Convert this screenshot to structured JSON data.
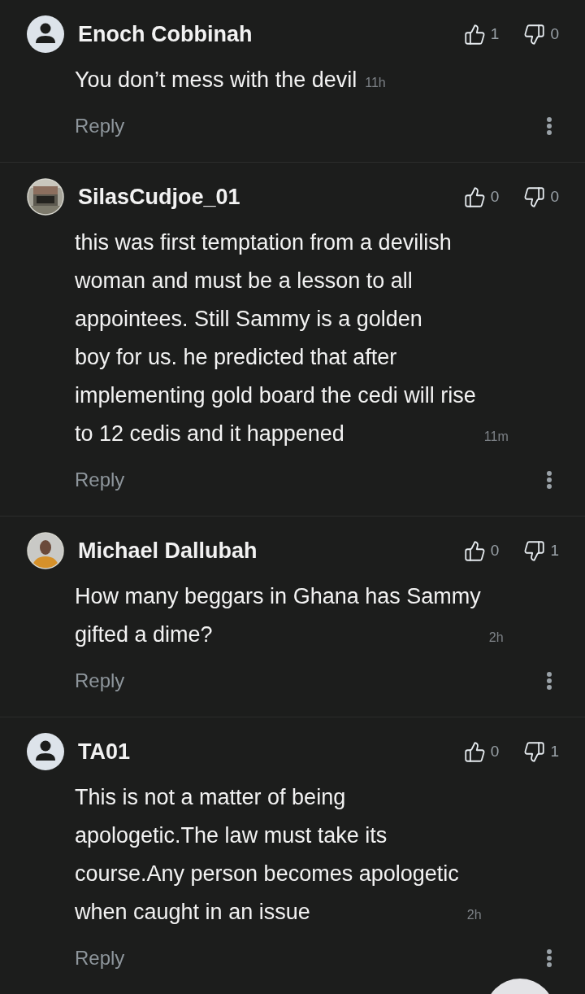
{
  "comments": [
    {
      "author": "Enoch Cobbinah",
      "avatar": {
        "kind": "default"
      },
      "likes": "1",
      "dislikes": "0",
      "lines": [
        "You don’t mess with the devil"
      ],
      "time": "11h",
      "reply": "Reply"
    },
    {
      "author": "SilasCudjoe_01",
      "likes": "0",
      "dislikes": "0",
      "lines": [
        "this was first temptation from a devilish",
        "woman and must be a lesson to all",
        "appointees. Still Sammy is a golden",
        "boy for us. he predicted that after",
        "implementing gold board the cedi will rise",
        "to 12 cedis and it happened"
      ],
      "time": "11m",
      "reply": "Reply"
    },
    {
      "author": "Michael Dallubah",
      "avatar": {
        "kind": "portrait"
      },
      "likes": "0",
      "dislikes": "1",
      "lines": [
        "How many beggars in Ghana has Sammy",
        "gifted a dime?"
      ],
      "time": "2h",
      "reply": "Reply"
    },
    {
      "author": "TA01",
      "avatar": {
        "kind": "default"
      },
      "likes": "0",
      "dislikes": "1",
      "lines": [
        "This is not a matter of being",
        "apologetic.The law must take its",
        "course.Any person becomes apologetic",
        "when caught in an issue"
      ],
      "time": "2h",
      "reply": "Reply"
    }
  ]
}
